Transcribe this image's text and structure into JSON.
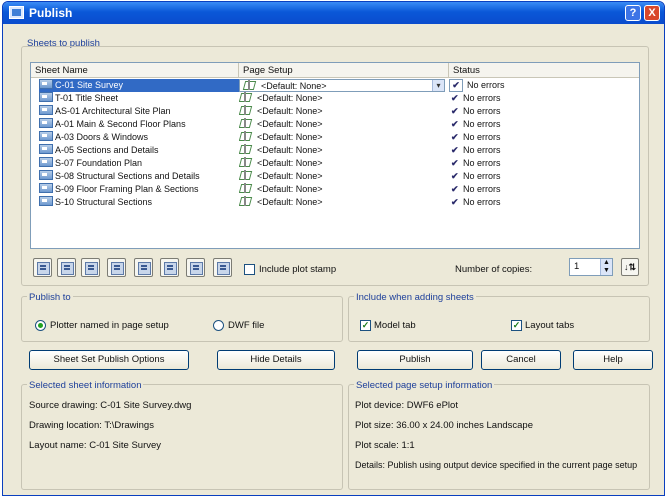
{
  "window": {
    "title": "Publish",
    "help_glyph": "?",
    "close_glyph": "X"
  },
  "sheets": {
    "section_label": "Sheets to publish",
    "columns": [
      "Sheet Name",
      "Page Setup",
      "Status"
    ],
    "rows": [
      {
        "name": "C-01 Site Survey",
        "setup": "<Default: None>",
        "status": "No errors",
        "selected": true
      },
      {
        "name": "T-01 Title Sheet",
        "setup": "<Default: None>",
        "status": "No errors"
      },
      {
        "name": "AS-01 Architectural Site Plan",
        "setup": "<Default: None>",
        "status": "No errors"
      },
      {
        "name": "A-01 Main & Second Floor Plans",
        "setup": "<Default: None>",
        "status": "No errors"
      },
      {
        "name": "A-03 Doors & Windows",
        "setup": "<Default: None>",
        "status": "No errors"
      },
      {
        "name": "A-05 Sections and Details",
        "setup": "<Default: None>",
        "status": "No errors"
      },
      {
        "name": "S-07 Foundation Plan",
        "setup": "<Default: None>",
        "status": "No errors"
      },
      {
        "name": "S-08 Structural Sections and Details",
        "setup": "<Default: None>",
        "status": "No errors"
      },
      {
        "name": "S-09 Floor Framing Plan & Sections",
        "setup": "<Default: None>",
        "status": "No errors"
      },
      {
        "name": "S-10 Structural Sections",
        "setup": "<Default: None>",
        "status": "No errors"
      }
    ],
    "check_glyph": "✔",
    "combo_arrow": "▾"
  },
  "toolbar": {
    "icons": [
      "preview-icon",
      "add-sheets-icon",
      "remove-sheets-icon",
      "move-up-icon",
      "move-down-icon",
      "load-list-icon",
      "save-list-icon",
      "plot-stamp-settings-icon"
    ],
    "include_plot_stamp_label": "Include plot stamp",
    "include_plot_stamp_checked": false,
    "copies_label": "Number of copies:",
    "copies_value": "1",
    "spin_up": "▲",
    "spin_down": "▼",
    "sort_glyph": "↓⇅"
  },
  "publish_to": {
    "label": "Publish to",
    "options": [
      {
        "label": "Plotter named in page setup",
        "selected": true
      },
      {
        "label": "DWF file",
        "selected": false
      }
    ]
  },
  "include_sheets": {
    "label": "Include when adding sheets",
    "model_tab_label": "Model tab",
    "model_tab_checked": true,
    "layout_tabs_label": "Layout tabs",
    "layout_tabs_checked": true,
    "check_glyph": "✓"
  },
  "buttons": {
    "sheet_set_options": "Sheet Set Publish Options",
    "hide_details": "Hide Details",
    "publish": "Publish",
    "cancel": "Cancel",
    "help": "Help"
  },
  "selected_sheet_info": {
    "label": "Selected sheet information",
    "source_drawing": "Source drawing: C-01 Site Survey.dwg",
    "drawing_location": "Drawing location: T:\\Drawings",
    "layout_name": "Layout name: C-01 Site Survey"
  },
  "page_setup_info": {
    "label": "Selected page setup information",
    "plot_device": "Plot device: DWF6 ePlot",
    "plot_size": "Plot size: 36.00 x 24.00 inches Landscape",
    "plot_scale": "Plot scale: 1:1",
    "details": "Details: Publish using output device specified in the current page setup"
  }
}
